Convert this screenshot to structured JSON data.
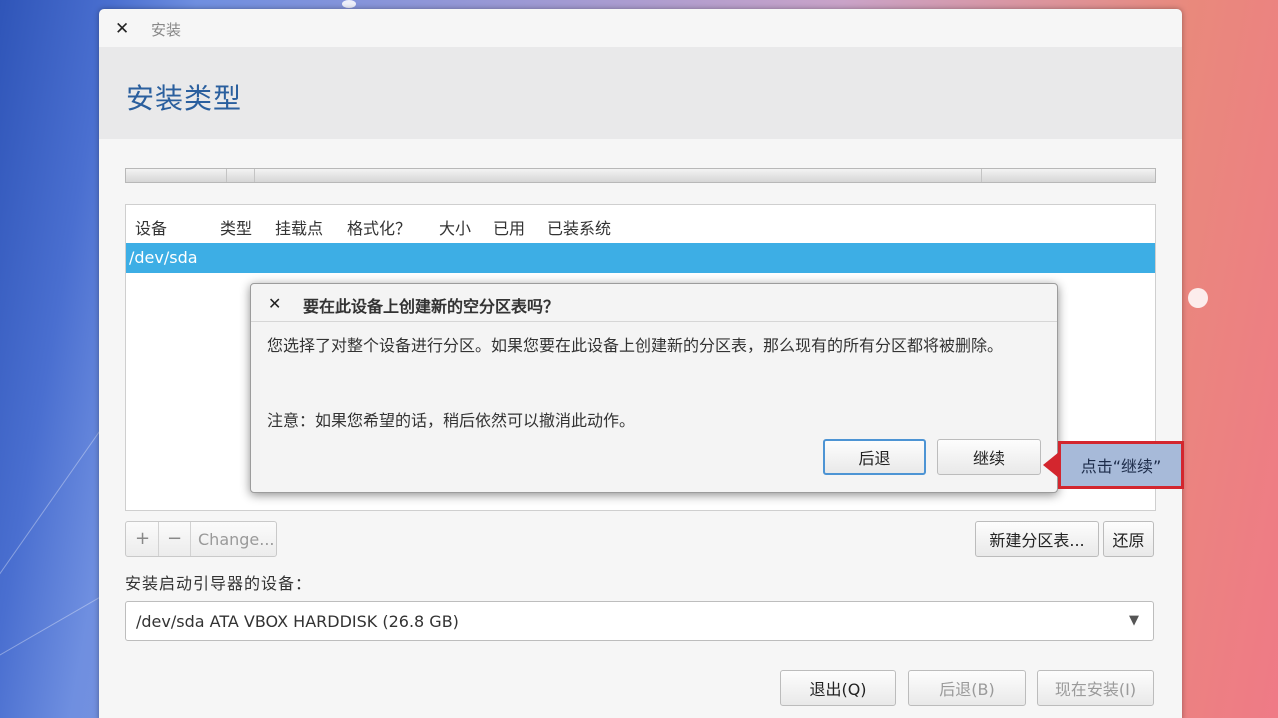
{
  "window": {
    "title": "安装",
    "page_title": "安装类型"
  },
  "table": {
    "columns": [
      "设备",
      "类型",
      "挂载点",
      "格式化？",
      "大小",
      "已用",
      "已装系统"
    ],
    "rows": [
      {
        "device": "/dev/sda"
      }
    ]
  },
  "toolbar": {
    "add_label": "+",
    "remove_label": "−",
    "change_label": "Change..."
  },
  "actions": {
    "new_table_label": "新建分区表...",
    "revert_label": "还原"
  },
  "bootloader": {
    "label": "安装启动引导器的设备：",
    "selected": "/dev/sda  ATA VBOX HARDDISK (26.8 GB)"
  },
  "footer": {
    "quit_label": "退出(Q)",
    "back_label": "后退(B)",
    "install_label": "现在安装(I)"
  },
  "dialog": {
    "title": "要在此设备上创建新的空分区表吗？",
    "message": "您选择了对整个设备进行分区。如果您要在此设备上创建新的分区表，那么现有的所有分区都将被删除。",
    "note": "注意：如果您希望的话，稍后依然可以撤消此动作。",
    "back_label": "后退",
    "continue_label": "继续"
  },
  "annotation": {
    "text": "点击“继续”",
    "border_color": "#d3262e"
  }
}
